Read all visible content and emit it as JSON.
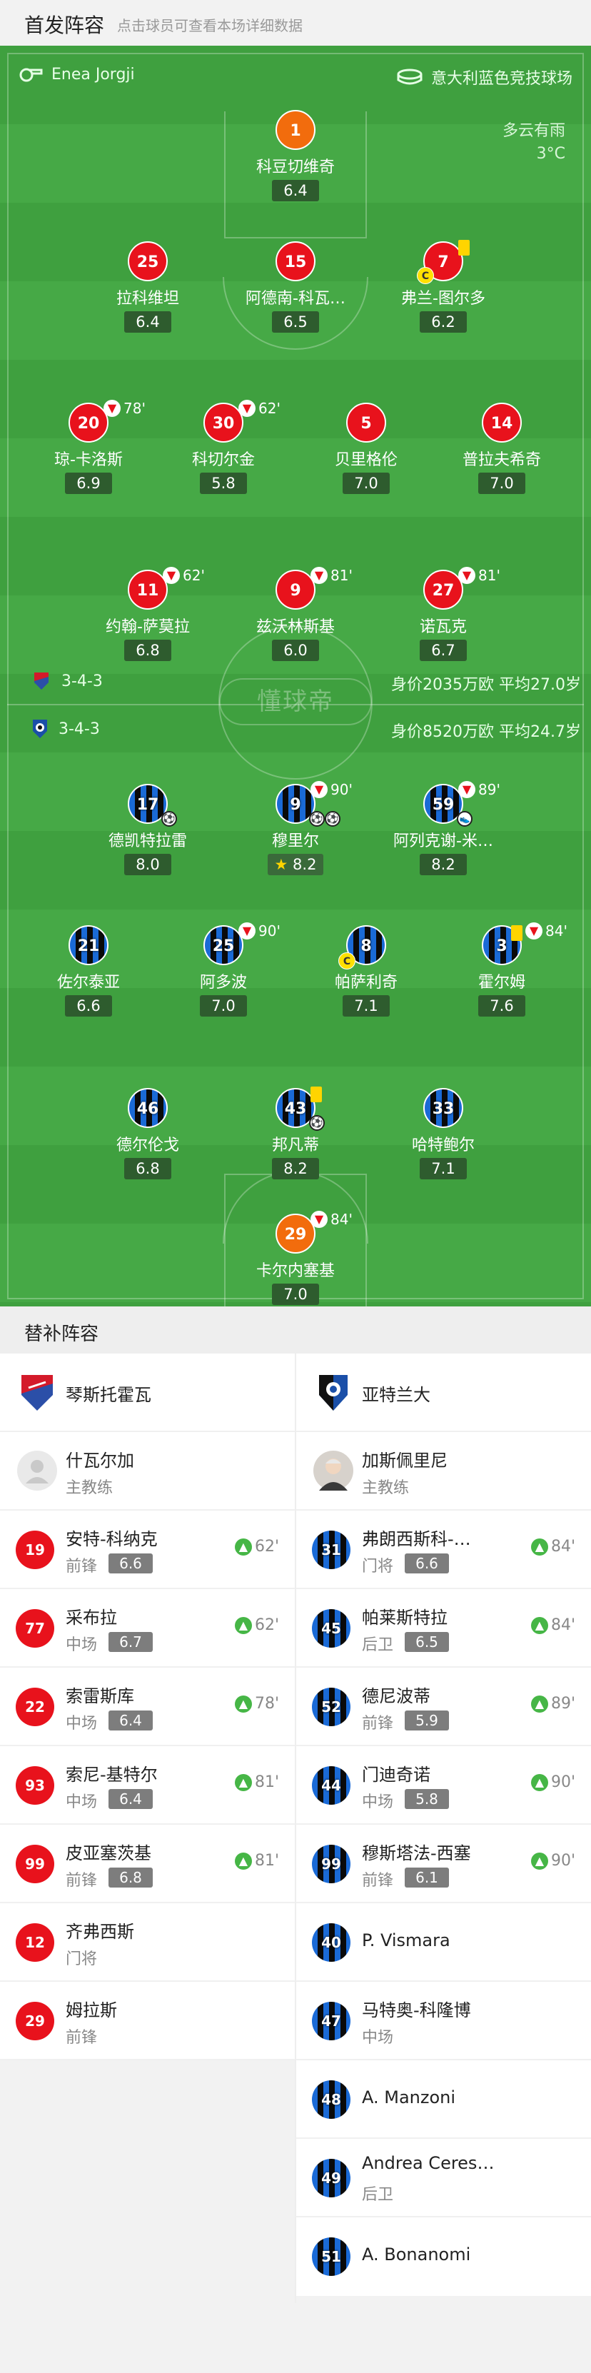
{
  "header": {
    "title": "首发阵容",
    "hint": "点击球员可查看本场详细数据"
  },
  "match": {
    "referee": "Enea Jorgji",
    "stadium": "意大利蓝色竞技球场",
    "weather": "多云有雨",
    "temperature": "3°C",
    "watermark": "懂球帝"
  },
  "home": {
    "formation": "3-4-3",
    "value": "身价2035万欧 平均27.0岁"
  },
  "away": {
    "formation": "3-4-3",
    "value": "身价8520万欧 平均24.7岁"
  },
  "home_players": [
    {
      "num": "1",
      "name": "科豆切维奇",
      "rating": "6.4"
    },
    {
      "num": "25",
      "name": "拉科维坦",
      "rating": "6.4"
    },
    {
      "num": "15",
      "name": "阿德南-科瓦…",
      "rating": "6.5"
    },
    {
      "num": "7",
      "name": "弗兰-图尔多",
      "rating": "6.2"
    },
    {
      "num": "20",
      "name": "琼-卡洛斯",
      "rating": "6.9",
      "sub": "78'"
    },
    {
      "num": "30",
      "name": "科切尔金",
      "rating": "5.8",
      "sub": "62'"
    },
    {
      "num": "5",
      "name": "贝里格伦",
      "rating": "7.0"
    },
    {
      "num": "14",
      "name": "普拉夫希奇",
      "rating": "7.0"
    },
    {
      "num": "11",
      "name": "约翰-萨莫拉",
      "rating": "6.8",
      "sub": "62'"
    },
    {
      "num": "9",
      "name": "兹沃林斯基",
      "rating": "6.0",
      "sub": "81'"
    },
    {
      "num": "27",
      "name": "诺瓦克",
      "rating": "6.7",
      "sub": "81'"
    }
  ],
  "away_players": [
    {
      "num": "17",
      "name": "德凯特拉雷",
      "rating": "8.0"
    },
    {
      "num": "9",
      "name": "穆里尔",
      "rating": "8.2",
      "sub": "90'"
    },
    {
      "num": "59",
      "name": "阿列克谢-米…",
      "rating": "8.2",
      "sub": "89'"
    },
    {
      "num": "21",
      "name": "佐尔泰亚",
      "rating": "6.6"
    },
    {
      "num": "25",
      "name": "阿多波",
      "rating": "7.0",
      "sub": "90'"
    },
    {
      "num": "8",
      "name": "帕萨利奇",
      "rating": "7.1"
    },
    {
      "num": "3",
      "name": "霍尔姆",
      "rating": "7.6",
      "sub": "84'"
    },
    {
      "num": "46",
      "name": "德尔伦戈",
      "rating": "6.8"
    },
    {
      "num": "43",
      "name": "邦凡蒂",
      "rating": "8.2"
    },
    {
      "num": "33",
      "name": "哈特鲍尔",
      "rating": "7.1"
    },
    {
      "num": "29",
      "name": "卡尔内塞基",
      "rating": "7.0",
      "sub": "84'"
    }
  ],
  "subs": {
    "title": "替补阵容",
    "home_team": "琴斯托霍瓦",
    "away_team": "亚特兰大",
    "home_coach": {
      "name": "什瓦尔加",
      "role": "主教练"
    },
    "away_coach": {
      "name": "加斯佩里尼",
      "role": "主教练"
    },
    "home": [
      {
        "num": "19",
        "name": "安特-科纳克",
        "pos": "前锋",
        "rating": "6.6",
        "in": "62'"
      },
      {
        "num": "77",
        "name": "采布拉",
        "pos": "中场",
        "rating": "6.7",
        "in": "62'"
      },
      {
        "num": "22",
        "name": "索雷斯库",
        "pos": "中场",
        "rating": "6.4",
        "in": "78'"
      },
      {
        "num": "93",
        "name": "索尼-基特尔",
        "pos": "中场",
        "rating": "6.4",
        "in": "81'"
      },
      {
        "num": "99",
        "name": "皮亚塞茨基",
        "pos": "前锋",
        "rating": "6.8",
        "in": "81'"
      },
      {
        "num": "12",
        "name": "齐弗西斯",
        "pos": "门将"
      },
      {
        "num": "29",
        "name": "姆拉斯",
        "pos": "前锋"
      }
    ],
    "away": [
      {
        "num": "31",
        "name": "弗朗西斯科-…",
        "pos": "门将",
        "rating": "6.6",
        "in": "84'"
      },
      {
        "num": "45",
        "name": "帕莱斯特拉",
        "pos": "后卫",
        "rating": "6.5",
        "in": "84'"
      },
      {
        "num": "52",
        "name": "德尼波蒂",
        "pos": "前锋",
        "rating": "5.9",
        "in": "89'"
      },
      {
        "num": "44",
        "name": "门迪奇诺",
        "pos": "中场",
        "rating": "5.8",
        "in": "90'"
      },
      {
        "num": "99",
        "name": "穆斯塔法-西塞",
        "pos": "前锋",
        "rating": "6.1",
        "in": "90'"
      },
      {
        "num": "40",
        "name": "P. Vismara"
      },
      {
        "num": "47",
        "name": "马特奥-科隆博",
        "pos": "中场"
      },
      {
        "num": "48",
        "name": "A. Manzoni"
      },
      {
        "num": "49",
        "name": "Andrea Ceres…",
        "pos": "后卫"
      },
      {
        "num": "51",
        "name": "A. Bonanomi"
      }
    ]
  }
}
